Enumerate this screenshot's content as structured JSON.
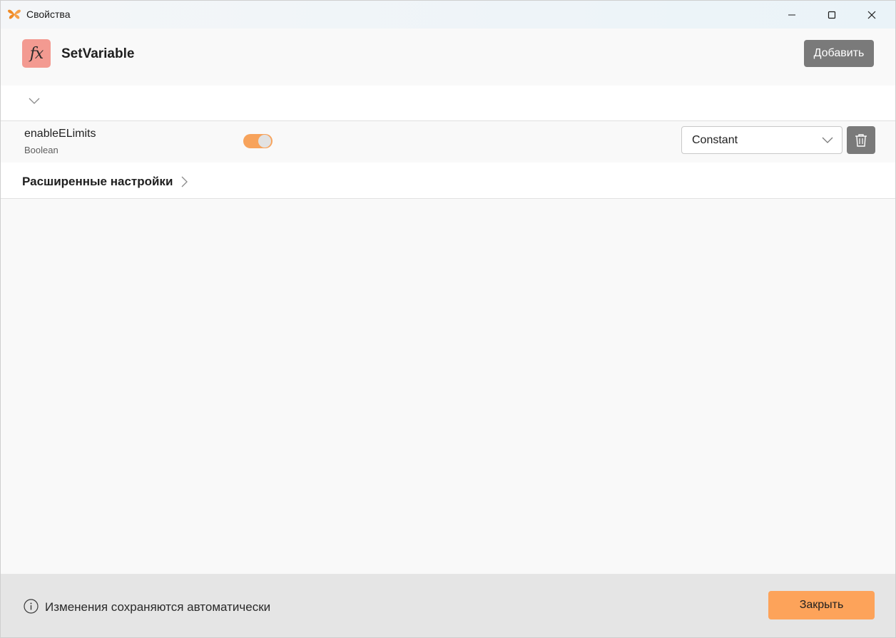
{
  "window": {
    "title": "Свойства",
    "accent_color": "#f7a35c"
  },
  "header": {
    "icon_label": "fx",
    "title": "SetVariable",
    "add_label": "Добавить"
  },
  "variable": {
    "name": "enableELimits",
    "type": "Boolean",
    "toggle_on": true,
    "source_selected": "Constant"
  },
  "advanced": {
    "label": "Расширенные настройки"
  },
  "footer": {
    "info_text": "Изменения сохраняются автоматически",
    "close_label": "Закрыть"
  },
  "colors": {
    "fx_badge": "#f39a91",
    "add_button": "#7a7a7a",
    "close_button": "#fda35a",
    "footer_bg": "#e5e5e5"
  }
}
